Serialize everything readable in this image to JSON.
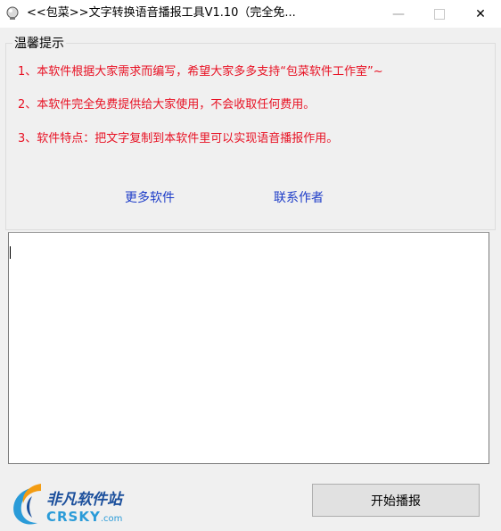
{
  "window": {
    "title": "<<包菜>>文字转换语音播报工具V1.10（完全免...",
    "minimize_glyph": "—",
    "close_glyph": "✕"
  },
  "notice": {
    "legend": "温馨提示",
    "tips": [
      "1、本软件根据大家需求而编写，希望大家多多支持“包菜软件工作室”~",
      "2、本软件完全免费提供给大家使用，不会收取任何费用。",
      "3、软件特点：把文字复制到本软件里可以实现语音播报作用。"
    ],
    "links": {
      "more_software": "更多软件",
      "contact_author": "联系作者"
    }
  },
  "editor": {
    "value": ""
  },
  "watermark": {
    "name_cn": "非凡软件站",
    "name_en": "CRSKY",
    "suffix": ".com"
  },
  "actions": {
    "play_label": "开始播报"
  },
  "colors": {
    "tip_red": "#e81123",
    "link_blue": "#1e3dc8",
    "logo_blue": "#1b4f9c",
    "logo_cyan": "#2a9bd8",
    "logo_orange": "#f39c12"
  },
  "icons": {
    "app": "lightbulb-app-icon",
    "minimize": "minimize-icon",
    "maximize": "maximize-icon",
    "close": "close-icon"
  }
}
